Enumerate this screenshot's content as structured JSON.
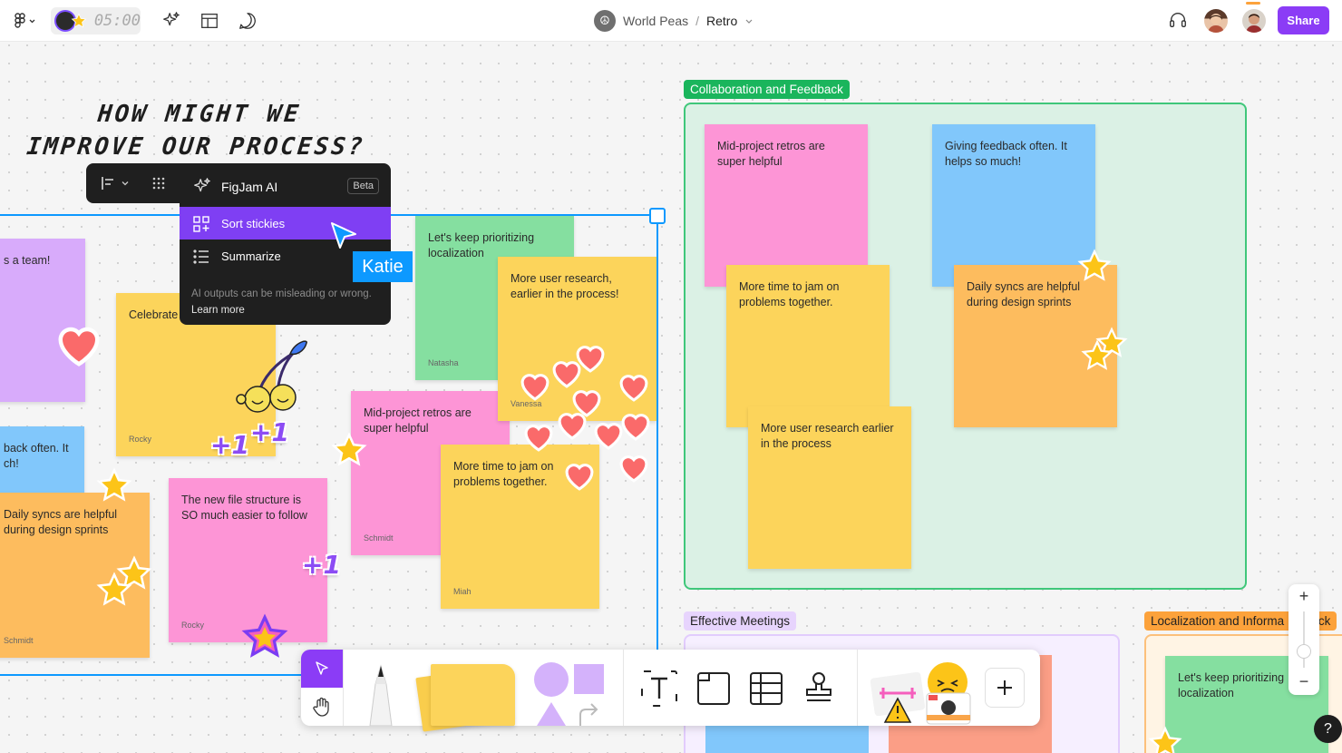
{
  "topbar": {
    "timer": "05:00",
    "file_team": "World Peas",
    "file_separator": "/",
    "file_name": "Retro",
    "share_label": "Share"
  },
  "board": {
    "heading_line1": "HOW MIGHT WE",
    "heading_line2": "IMPROVE OUR PROCESS?",
    "left_stickies": [
      {
        "text": "s a team!",
        "author": ""
      },
      {
        "text": "Celebrate",
        "author": "Rocky"
      },
      {
        "text": "back often. It\nch!",
        "author": ""
      },
      {
        "text": "Daily syncs are helpful during design sprints",
        "author": "Schmidt"
      },
      {
        "text": "The new file structure is SO much easier to follow",
        "author": "Rocky"
      },
      {
        "text": "Mid-project retros are super helpful",
        "author": "Schmidt"
      },
      {
        "text": "More time to jam on problems together.",
        "author": "Miah"
      },
      {
        "text": "Let's keep prioritizing localization",
        "author": "Natasha"
      },
      {
        "text": "More user research, earlier in the process!",
        "author": "Vanessa"
      }
    ],
    "sections": {
      "collab": {
        "label": "Collaboration and Feedback",
        "stickies": [
          {
            "text": "Mid-project retros are super helpful"
          },
          {
            "text": "Giving feedback often. It helps so much!"
          },
          {
            "text": "More time to jam on problems together."
          },
          {
            "text": "Daily syncs are helpful during design sprints"
          },
          {
            "text": "More user research earlier in the process"
          }
        ]
      },
      "meetings": {
        "label": "Effective Meetings"
      },
      "localization": {
        "label": "Localization and Informa",
        "label_tail": "Track",
        "sticky": "Let's keep prioritizing localization"
      }
    },
    "plus_one": "+1"
  },
  "ai_menu": {
    "title": "FigJam AI",
    "badge": "Beta",
    "items": [
      "Sort stickies",
      "Summarize"
    ],
    "note": "AI outputs can be misleading or wrong.",
    "learn_more": "Learn more"
  },
  "cursor_user": "Katie",
  "zoom": {
    "in": "+",
    "out": "−"
  },
  "help": "?",
  "colors": {
    "accent": "#8b3cf6",
    "selection": "#0d99ff",
    "collab_section": "#1ab55c",
    "meetings_section": "#d3b4fb",
    "localization_section": "#fca23b"
  },
  "icons": [
    "figma-logo-icon",
    "sparkle-icon",
    "layout-icon",
    "comment-icon",
    "headphones-icon",
    "align-icon",
    "grid-icon",
    "sort-icon",
    "list-icon",
    "cursor-icon",
    "hand-icon",
    "pen-icon",
    "shape-icon",
    "text-icon",
    "section-icon",
    "table-icon",
    "stamp-icon",
    "plus-icon",
    "star-icon",
    "heart-icon",
    "cherry-icon"
  ]
}
